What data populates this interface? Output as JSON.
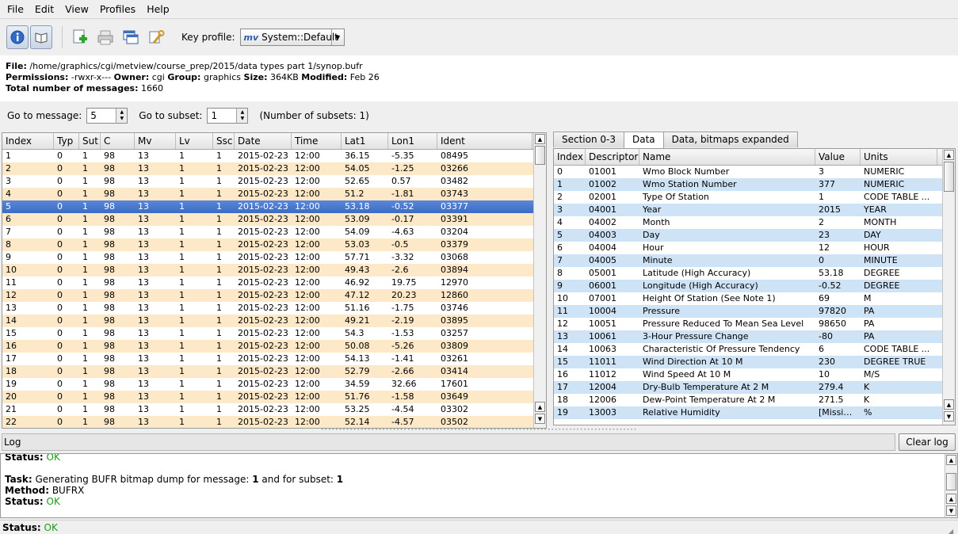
{
  "menu": [
    "File",
    "Edit",
    "View",
    "Profiles",
    "Help"
  ],
  "toolbar": {
    "key_profile_label": "Key profile:",
    "key_profile_value": "System::Default",
    "mv_logo": "mv"
  },
  "info": {
    "file_label": "File:",
    "file": "/home/graphics/cgi/metview/course_prep/2015/data types part 1/synop.bufr",
    "perm_label": "Permissions:",
    "perm": "-rwxr-x---",
    "owner_label": "Owner:",
    "owner": "cgi",
    "group_label": "Group:",
    "group": "graphics",
    "size_label": "Size:",
    "size": "364KB",
    "modified_label": "Modified:",
    "modified": "Feb 26",
    "total_label": "Total number of messages:",
    "total": "1660"
  },
  "goto": {
    "msg_label": "Go to message:",
    "msg_value": "5",
    "subset_label": "Go to subset:",
    "subset_value": "1",
    "nsubsets": "(Number of subsets: 1)"
  },
  "left_table": {
    "headers": [
      "Index",
      "Typ",
      "Sut",
      "C",
      "Mv",
      "Lv",
      "Ssc",
      "Date",
      "Time",
      "Lat1",
      "Lon1",
      "Ident"
    ],
    "rows": [
      [
        "1",
        "0",
        "1",
        "98",
        "13",
        "1",
        "1",
        "2015-02-23",
        "12:00",
        "36.15",
        "-5.35",
        "08495"
      ],
      [
        "2",
        "0",
        "1",
        "98",
        "13",
        "1",
        "1",
        "2015-02-23",
        "12:00",
        "54.05",
        "-1.25",
        "03266"
      ],
      [
        "3",
        "0",
        "1",
        "98",
        "13",
        "1",
        "1",
        "2015-02-23",
        "12:00",
        "52.65",
        "0.57",
        "03482"
      ],
      [
        "4",
        "0",
        "1",
        "98",
        "13",
        "1",
        "1",
        "2015-02-23",
        "12:00",
        "51.2",
        "-1.81",
        "03743"
      ],
      [
        "5",
        "0",
        "1",
        "98",
        "13",
        "1",
        "1",
        "2015-02-23",
        "12:00",
        "53.18",
        "-0.52",
        "03377"
      ],
      [
        "6",
        "0",
        "1",
        "98",
        "13",
        "1",
        "1",
        "2015-02-23",
        "12:00",
        "53.09",
        "-0.17",
        "03391"
      ],
      [
        "7",
        "0",
        "1",
        "98",
        "13",
        "1",
        "1",
        "2015-02-23",
        "12:00",
        "54.09",
        "-4.63",
        "03204"
      ],
      [
        "8",
        "0",
        "1",
        "98",
        "13",
        "1",
        "1",
        "2015-02-23",
        "12:00",
        "53.03",
        "-0.5",
        "03379"
      ],
      [
        "9",
        "0",
        "1",
        "98",
        "13",
        "1",
        "1",
        "2015-02-23",
        "12:00",
        "57.71",
        "-3.32",
        "03068"
      ],
      [
        "10",
        "0",
        "1",
        "98",
        "13",
        "1",
        "1",
        "2015-02-23",
        "12:00",
        "49.43",
        "-2.6",
        "03894"
      ],
      [
        "11",
        "0",
        "1",
        "98",
        "13",
        "1",
        "1",
        "2015-02-23",
        "12:00",
        "46.92",
        "19.75",
        "12970"
      ],
      [
        "12",
        "0",
        "1",
        "98",
        "13",
        "1",
        "1",
        "2015-02-23",
        "12:00",
        "47.12",
        "20.23",
        "12860"
      ],
      [
        "13",
        "0",
        "1",
        "98",
        "13",
        "1",
        "1",
        "2015-02-23",
        "12:00",
        "51.16",
        "-1.75",
        "03746"
      ],
      [
        "14",
        "0",
        "1",
        "98",
        "13",
        "1",
        "1",
        "2015-02-23",
        "12:00",
        "49.21",
        "-2.19",
        "03895"
      ],
      [
        "15",
        "0",
        "1",
        "98",
        "13",
        "1",
        "1",
        "2015-02-23",
        "12:00",
        "54.3",
        "-1.53",
        "03257"
      ],
      [
        "16",
        "0",
        "1",
        "98",
        "13",
        "1",
        "1",
        "2015-02-23",
        "12:00",
        "50.08",
        "-5.26",
        "03809"
      ],
      [
        "17",
        "0",
        "1",
        "98",
        "13",
        "1",
        "1",
        "2015-02-23",
        "12:00",
        "54.13",
        "-1.41",
        "03261"
      ],
      [
        "18",
        "0",
        "1",
        "98",
        "13",
        "1",
        "1",
        "2015-02-23",
        "12:00",
        "52.79",
        "-2.66",
        "03414"
      ],
      [
        "19",
        "0",
        "1",
        "98",
        "13",
        "1",
        "1",
        "2015-02-23",
        "12:00",
        "34.59",
        "32.66",
        "17601"
      ],
      [
        "20",
        "0",
        "1",
        "98",
        "13",
        "1",
        "1",
        "2015-02-23",
        "12:00",
        "51.76",
        "-1.58",
        "03649"
      ],
      [
        "21",
        "0",
        "1",
        "98",
        "13",
        "1",
        "1",
        "2015-02-23",
        "12:00",
        "53.25",
        "-4.54",
        "03302"
      ],
      [
        "22",
        "0",
        "1",
        "98",
        "13",
        "1",
        "1",
        "2015-02-23",
        "12:00",
        "52.14",
        "-4.57",
        "03502"
      ]
    ],
    "selected_row": 5
  },
  "tabs": [
    "Section 0-3",
    "Data",
    "Data, bitmaps expanded"
  ],
  "active_tab": 1,
  "right_table": {
    "headers": [
      "Index",
      "Descriptor",
      "Name",
      "Value",
      "Units"
    ],
    "rows": [
      [
        "0",
        "01001",
        "Wmo Block Number",
        "3",
        "NUMERIC"
      ],
      [
        "1",
        "01002",
        "Wmo Station Number",
        "377",
        "NUMERIC"
      ],
      [
        "2",
        "02001",
        "Type Of Station",
        "1",
        "CODE TABLE ..."
      ],
      [
        "3",
        "04001",
        "Year",
        "2015",
        "YEAR"
      ],
      [
        "4",
        "04002",
        "Month",
        "2",
        "MONTH"
      ],
      [
        "5",
        "04003",
        "Day",
        "23",
        "DAY"
      ],
      [
        "6",
        "04004",
        "Hour",
        "12",
        "HOUR"
      ],
      [
        "7",
        "04005",
        "Minute",
        "0",
        "MINUTE"
      ],
      [
        "8",
        "05001",
        "Latitude (High Accuracy)",
        "53.18",
        "DEGREE"
      ],
      [
        "9",
        "06001",
        "Longitude (High Accuracy)",
        "-0.52",
        "DEGREE"
      ],
      [
        "10",
        "07001",
        "Height Of Station (See Note 1)",
        "69",
        "M"
      ],
      [
        "11",
        "10004",
        "Pressure",
        "97820",
        "PA"
      ],
      [
        "12",
        "10051",
        "Pressure Reduced To Mean Sea Level",
        "98650",
        "PA"
      ],
      [
        "13",
        "10061",
        "3-Hour Pressure Change",
        "-80",
        "PA"
      ],
      [
        "14",
        "10063",
        "Characteristic Of Pressure Tendency",
        "6",
        "CODE TABLE ..."
      ],
      [
        "15",
        "11011",
        "Wind Direction At 10 M",
        "230",
        "DEGREE TRUE"
      ],
      [
        "16",
        "11012",
        "Wind Speed At 10 M",
        "10",
        "M/S"
      ],
      [
        "17",
        "12004",
        "Dry-Bulb Temperature At 2 M",
        "279.4",
        "K"
      ],
      [
        "18",
        "12006",
        "Dew-Point Temperature At 2 M",
        "271.5",
        "K"
      ],
      [
        "19",
        "13003",
        "Relative Humidity",
        "[Missing]",
        "%"
      ]
    ]
  },
  "log": {
    "title": "Log",
    "clear": "Clear log",
    "status_label": "Status:",
    "ok": "OK",
    "task_label": "Task:",
    "task_text": "Generating BUFR bitmap dump for message:",
    "task_msg": "1",
    "task_mid": "and for subset:",
    "task_subset": "1",
    "method_label": "Method:",
    "method": "BUFRX"
  },
  "statusbar": {
    "label": "Status:",
    "value": "OK"
  },
  "colors": {
    "row_alt_left": "#fde8c8",
    "row_alt_right": "#cfe3f6",
    "selection": "#3a6cc8",
    "ok": "#1a9a1a"
  }
}
